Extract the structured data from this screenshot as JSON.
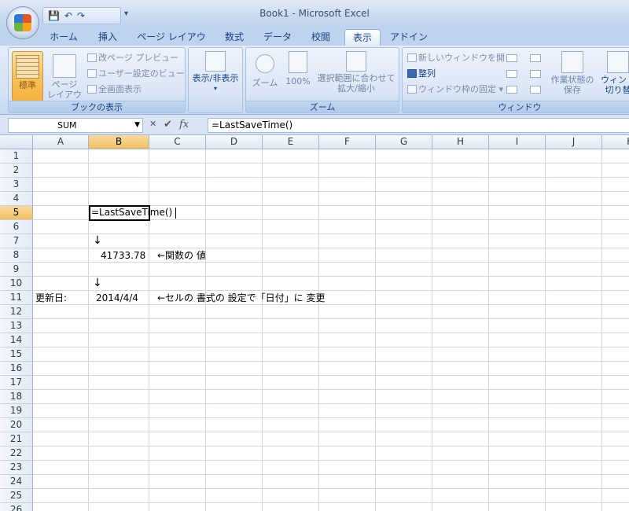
{
  "title": "Book1 - Microsoft Excel",
  "qat": {
    "save": "💾",
    "undo": "↶",
    "redo": "↷",
    "more": "▾"
  },
  "tabs": [
    "ホーム",
    "挿入",
    "ページ レイアウト",
    "数式",
    "データ",
    "校閲",
    "表示",
    "アドイン"
  ],
  "active_tab": "表示",
  "ribbon": {
    "book_view": {
      "label": "ブックの表示",
      "normal": "標準",
      "page_layout": [
        "ページ",
        "レイアウト"
      ],
      "page_break_preview": "改ページ プレビュー",
      "custom_views": "ユーザー設定のビュー",
      "full_screen": "全画面表示"
    },
    "show_hide": {
      "label": "表示/非表示"
    },
    "zoom": {
      "label": "ズーム",
      "zoom": "ズーム",
      "hundred": "100%",
      "zoom_to_selection": [
        "選択範囲に合わせて",
        "拡大/縮小"
      ]
    },
    "window": {
      "label": "ウィンドウ",
      "new_window": "新しいウィンドウを開く",
      "arrange": "整列",
      "freeze": "ウィンドウ枠の固定",
      "save_workspace": [
        "作業状態の",
        "保存"
      ],
      "switch_windows": [
        "ウィンド",
        "切り替"
      ]
    }
  },
  "formula_bar": {
    "name_box": "SUM",
    "formula": "=LastSaveTime()"
  },
  "columns": [
    "A",
    "B",
    "C",
    "D",
    "E",
    "F",
    "G",
    "H",
    "I",
    "J",
    "K"
  ],
  "rows": [
    "1",
    "2",
    "3",
    "4",
    "5",
    "6",
    "7",
    "8",
    "9",
    "10",
    "11",
    "12",
    "13",
    "14",
    "15",
    "16",
    "17",
    "18",
    "19",
    "20",
    "21",
    "22",
    "23",
    "24",
    "25",
    "26"
  ],
  "selected_column": "B",
  "selected_row": "5",
  "cells": {
    "B5": "=LastSaveTime()",
    "B7": "↓",
    "B8": "41733.78",
    "C8": "←関数の 値",
    "B10": "↓",
    "A11": "更新日:",
    "B11": "2014/4/4",
    "C11": "←セルの 書式の 設定で「日付」に 変更"
  }
}
